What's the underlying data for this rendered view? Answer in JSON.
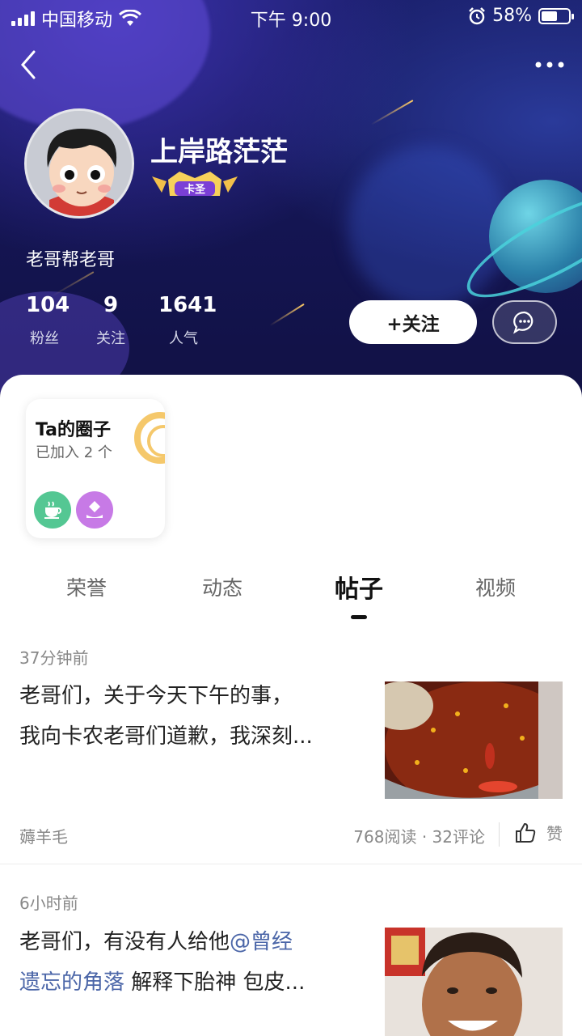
{
  "status_bar": {
    "carrier": "中国移动",
    "time": "下午 9:00",
    "battery": "58%",
    "battery_level": 0.58
  },
  "profile": {
    "name": "上岸路茫茫",
    "level_badge": "卡圣",
    "bio": "老哥帮老哥",
    "stats": [
      {
        "value": "104",
        "label": "粉丝"
      },
      {
        "value": "9",
        "label": "关注"
      },
      {
        "value": "1641",
        "label": "人气"
      }
    ],
    "follow_label": "+关注"
  },
  "circle_card": {
    "title": "Ta的圈子",
    "subtitle": "已加入 2 个"
  },
  "tabs": [
    {
      "label": "荣誉",
      "active": false
    },
    {
      "label": "动态",
      "active": false
    },
    {
      "label": "帖子",
      "active": true
    },
    {
      "label": "视频",
      "active": false
    }
  ],
  "posts": [
    {
      "time": "37分钟前",
      "text_line1": "老哥们，关于今天下午的事，",
      "text_line2": "我向卡农老哥们道歉，我深刻...",
      "author": "薅羊毛",
      "meta": "768阅读 · 32评论",
      "like_label": "赞"
    },
    {
      "time": "6小时前",
      "text_line1_plain": "老哥们，有没有人给他",
      "mention": "@曾经",
      "mention_line2": "遗忘的角落",
      "text_line2_rest": " 解释下胎神  包皮..."
    }
  ],
  "colors": {
    "banner_dark": "#141552",
    "accent_mention": "#4b66a8",
    "circle_green": "#54c793",
    "circle_purple": "#c77ae6"
  },
  "icons": [
    "signal-icon",
    "wifi-icon",
    "alarm-icon",
    "battery-icon",
    "back-arrow-icon",
    "more-dots-icon",
    "chat-bubble-icon",
    "tea-cup-icon",
    "diamond-hand-icon",
    "thumbs-up-icon"
  ]
}
